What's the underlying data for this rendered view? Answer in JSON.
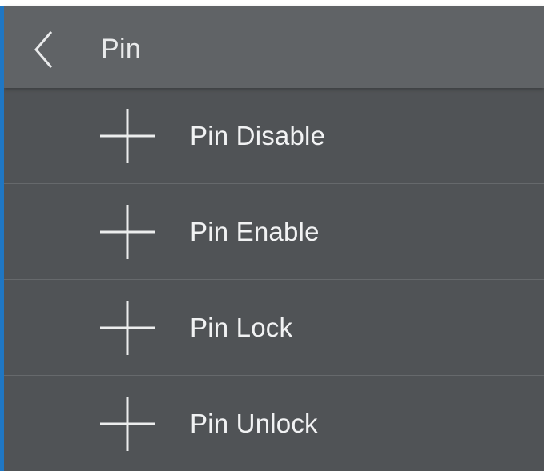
{
  "header": {
    "title": "Pin",
    "back_icon": "chevron-left-icon"
  },
  "menu": {
    "items": [
      {
        "label": "Pin Disable",
        "icon": "plus-icon"
      },
      {
        "label": "Pin Enable",
        "icon": "plus-icon"
      },
      {
        "label": "Pin Lock",
        "icon": "plus-icon"
      },
      {
        "label": "Pin Unlock",
        "icon": "plus-icon"
      }
    ]
  },
  "colors": {
    "header_background": "#606366",
    "list_background": "#505356",
    "accent": "#1f77c4",
    "text": "#f1f2f3"
  }
}
